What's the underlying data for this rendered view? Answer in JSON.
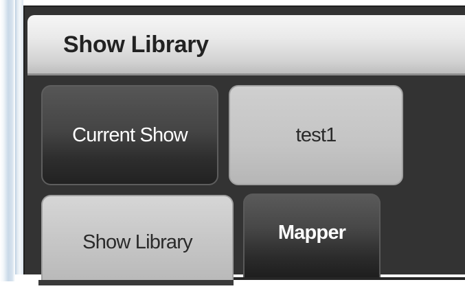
{
  "window": {
    "title": "Show Library"
  },
  "buttons": {
    "current_show": "Current Show",
    "show_name": "test1"
  },
  "tabs": [
    {
      "label": "Show Library",
      "active": true
    },
    {
      "label": "Mapper",
      "active": false
    }
  ],
  "colors": {
    "panel_background": "#333333",
    "title_bar": "#e0e0e0",
    "active_tab": "#c4c4c4",
    "dark_button": "#3a3a3a",
    "light_button": "#c4c4c4"
  }
}
